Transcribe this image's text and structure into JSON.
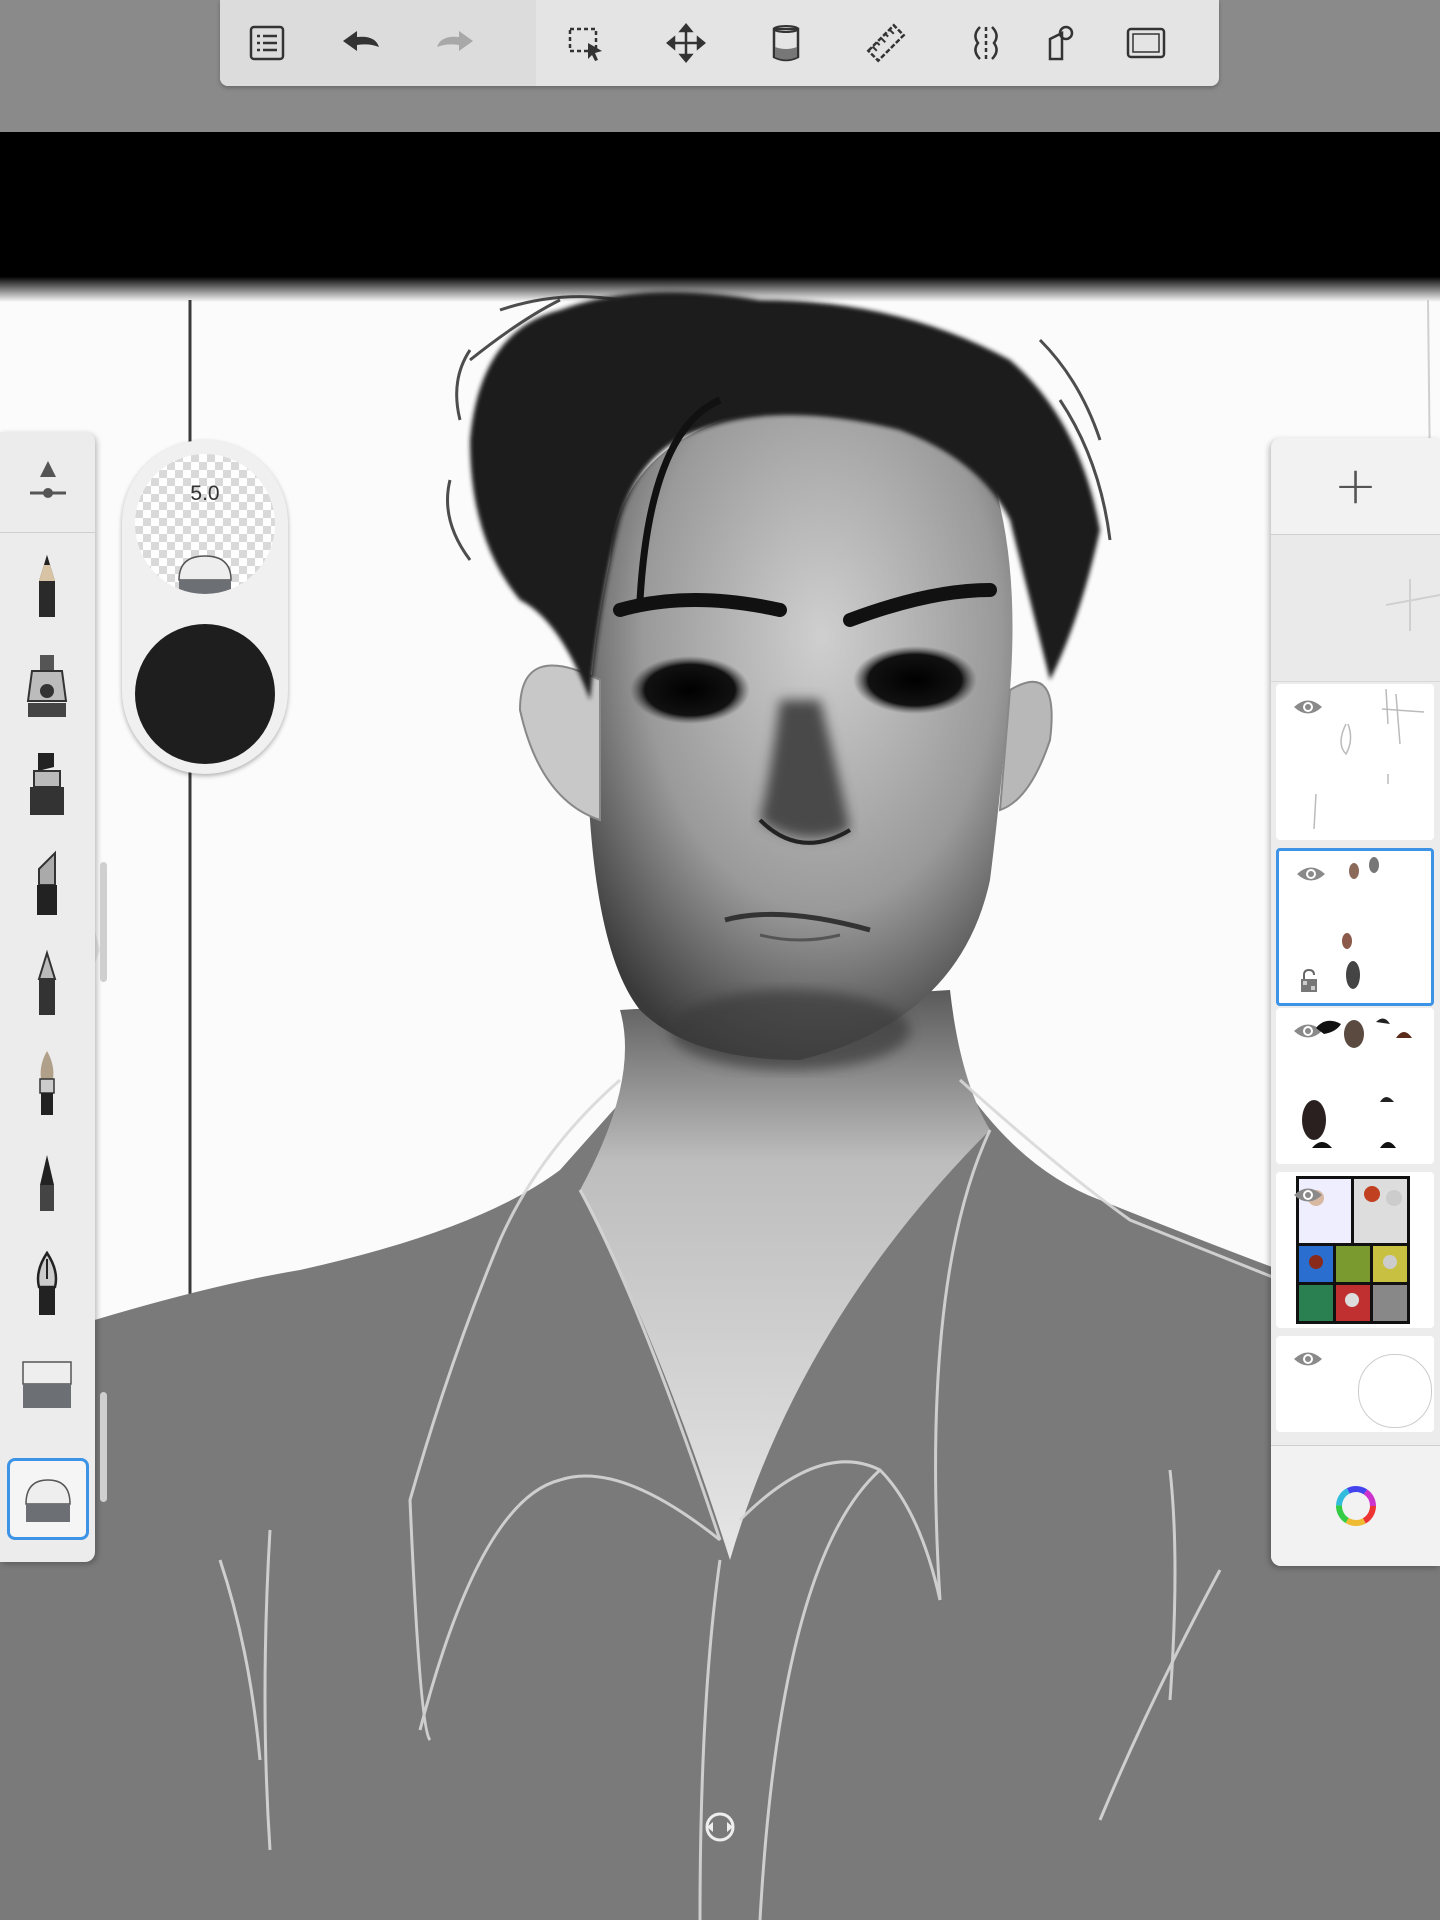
{
  "toolbar": {
    "items": [
      {
        "name": "list-icon"
      },
      {
        "name": "undo-icon"
      },
      {
        "name": "redo-icon"
      },
      {
        "name": "selection-icon"
      },
      {
        "name": "transform-icon"
      },
      {
        "name": "fill-icon"
      },
      {
        "name": "ruler-icon"
      },
      {
        "name": "symmetry-icon"
      },
      {
        "name": "perspective-icon"
      },
      {
        "name": "fullscreen-icon"
      }
    ]
  },
  "brush": {
    "size_label": "5.0",
    "color": "#1e1e1e"
  },
  "tools": [
    {
      "name": "pencil-tool-icon"
    },
    {
      "name": "airbrush-tool-icon"
    },
    {
      "name": "marker-tool-icon"
    },
    {
      "name": "chisel-tool-icon"
    },
    {
      "name": "ballpoint-pen-tool-icon"
    },
    {
      "name": "paintbrush-tool-icon"
    },
    {
      "name": "ink-pen-tool-icon"
    },
    {
      "name": "fountain-pen-tool-icon"
    },
    {
      "name": "eraser-tool-icon"
    },
    {
      "name": "soft-eraser-tool-icon",
      "selected": true
    }
  ],
  "layers": {
    "add_label": "+",
    "items": [
      {
        "name": "layer-sketch-lines",
        "visible": true
      },
      {
        "name": "layer-faces",
        "visible": true,
        "selected": true,
        "locked": true
      },
      {
        "name": "layer-hair-references",
        "visible": true
      },
      {
        "name": "layer-color-reference",
        "visible": true
      },
      {
        "name": "layer-background",
        "visible": true
      }
    ]
  },
  "colors": {
    "accent": "#3d93e6",
    "panel": "#ececec"
  }
}
